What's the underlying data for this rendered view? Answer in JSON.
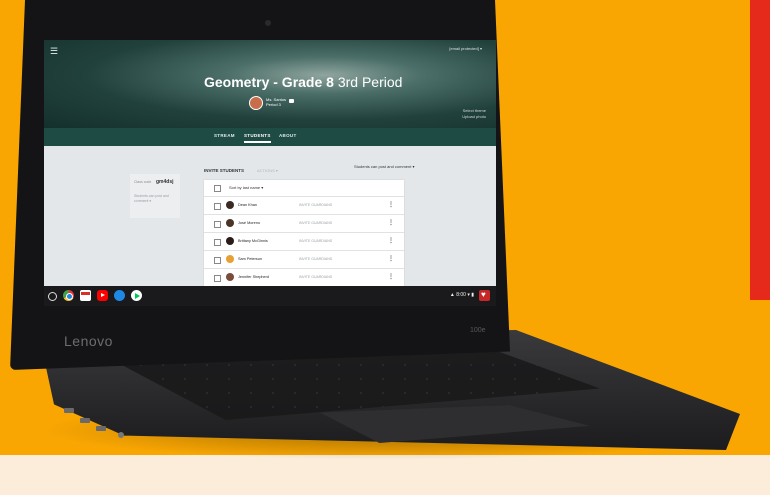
{
  "window": {
    "account_email": "[email protected] ▾",
    "menu_icon": "hamburger-menu-icon"
  },
  "classroom": {
    "title_bold": "Geometry - Grade 8",
    "title_period": " 3rd Period",
    "teacher_line1": "Ms. Santos",
    "teacher_line2": "Period 3",
    "theme_select": "Select theme",
    "theme_upload": "Upload photo"
  },
  "tabs": [
    {
      "label": "STREAM"
    },
    {
      "label": "STUDENTS"
    },
    {
      "label": "ABOUT"
    }
  ],
  "class_code": {
    "label": "Class code",
    "value": "gm4dsj",
    "permission_text": "Students can post and comment ▾"
  },
  "toolbar": {
    "invite_students": "INVITE STUDENTS",
    "actions": "ACTIONS ▾",
    "permission_select": "Students can post and comment ▾"
  },
  "table": {
    "sort_label": "Sort by last name ▾",
    "invite_label": "INVITE GUARDIANS",
    "rows": [
      {
        "name": "Dean Khan",
        "avatar_color": "#3b2a22"
      },
      {
        "name": "José Moreno",
        "avatar_color": "#4a3426"
      },
      {
        "name": "Brittany McGinnis",
        "avatar_color": "#2a1d18"
      },
      {
        "name": "Sam Peterson",
        "avatar_color": "#e8a034"
      },
      {
        "name": "Jennifer Shepherd",
        "avatar_color": "#7a4c3c"
      }
    ]
  },
  "shelf": {
    "time": "▲ 8:00 ▾ ▮",
    "apps": [
      "chrome-icon",
      "gmail-icon",
      "youtube-icon",
      "files-icon",
      "play-store-icon"
    ]
  },
  "device": {
    "brand": "Lenovo",
    "model": "100e"
  }
}
